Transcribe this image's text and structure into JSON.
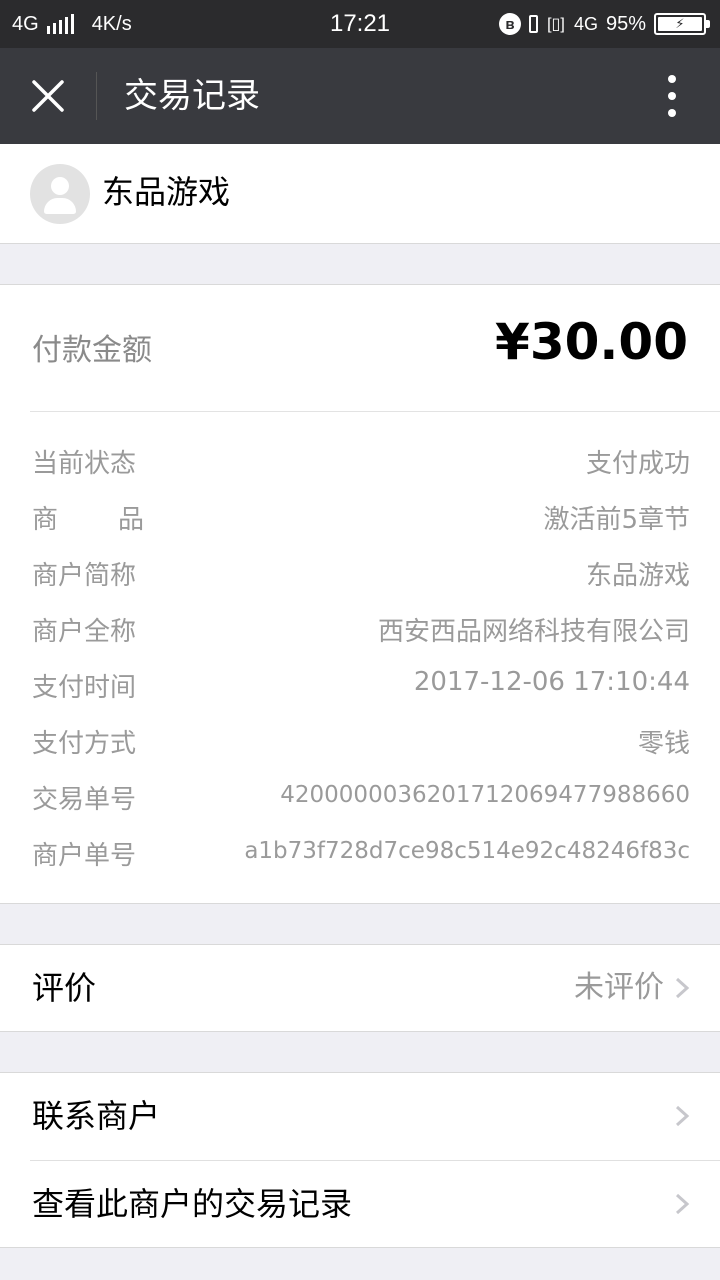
{
  "status_bar": {
    "network": "4G",
    "speed": "4K/s",
    "time": "17:21",
    "network_right": "4G",
    "battery": "95%"
  },
  "title_bar": {
    "title": "交易记录",
    "close_icon": "close-icon",
    "more_icon": "more-vertical-icon"
  },
  "merchant": {
    "name": "东品游戏"
  },
  "payment": {
    "amount_label": "付款金额",
    "amount": "¥30.00",
    "details": [
      {
        "key": "当前状态",
        "value": "支付成功"
      },
      {
        "key": "商品",
        "value": "激活前5章节"
      },
      {
        "key": "商户简称",
        "value": "东品游戏"
      },
      {
        "key": "商户全称",
        "value": "西安西品网络科技有限公司"
      },
      {
        "key": "支付时间",
        "value": "2017-12-06 17:10:44"
      },
      {
        "key": "支付方式",
        "value": "零钱"
      },
      {
        "key": "交易单号",
        "value": "4200000036201712069477988660"
      },
      {
        "key": "商户单号",
        "value": "a1b73f728d7ce98c514e92c48246f83c"
      }
    ]
  },
  "rating": {
    "label": "评价",
    "status": "未评价"
  },
  "links": {
    "contact": "联系商户",
    "history": "查看此商户的交易记录"
  },
  "colors": {
    "status_bar_bg": "#2b2b2d",
    "title_bar_bg": "#393a3f",
    "page_bg": "#efeff4",
    "muted_text": "#9a9a9a"
  }
}
